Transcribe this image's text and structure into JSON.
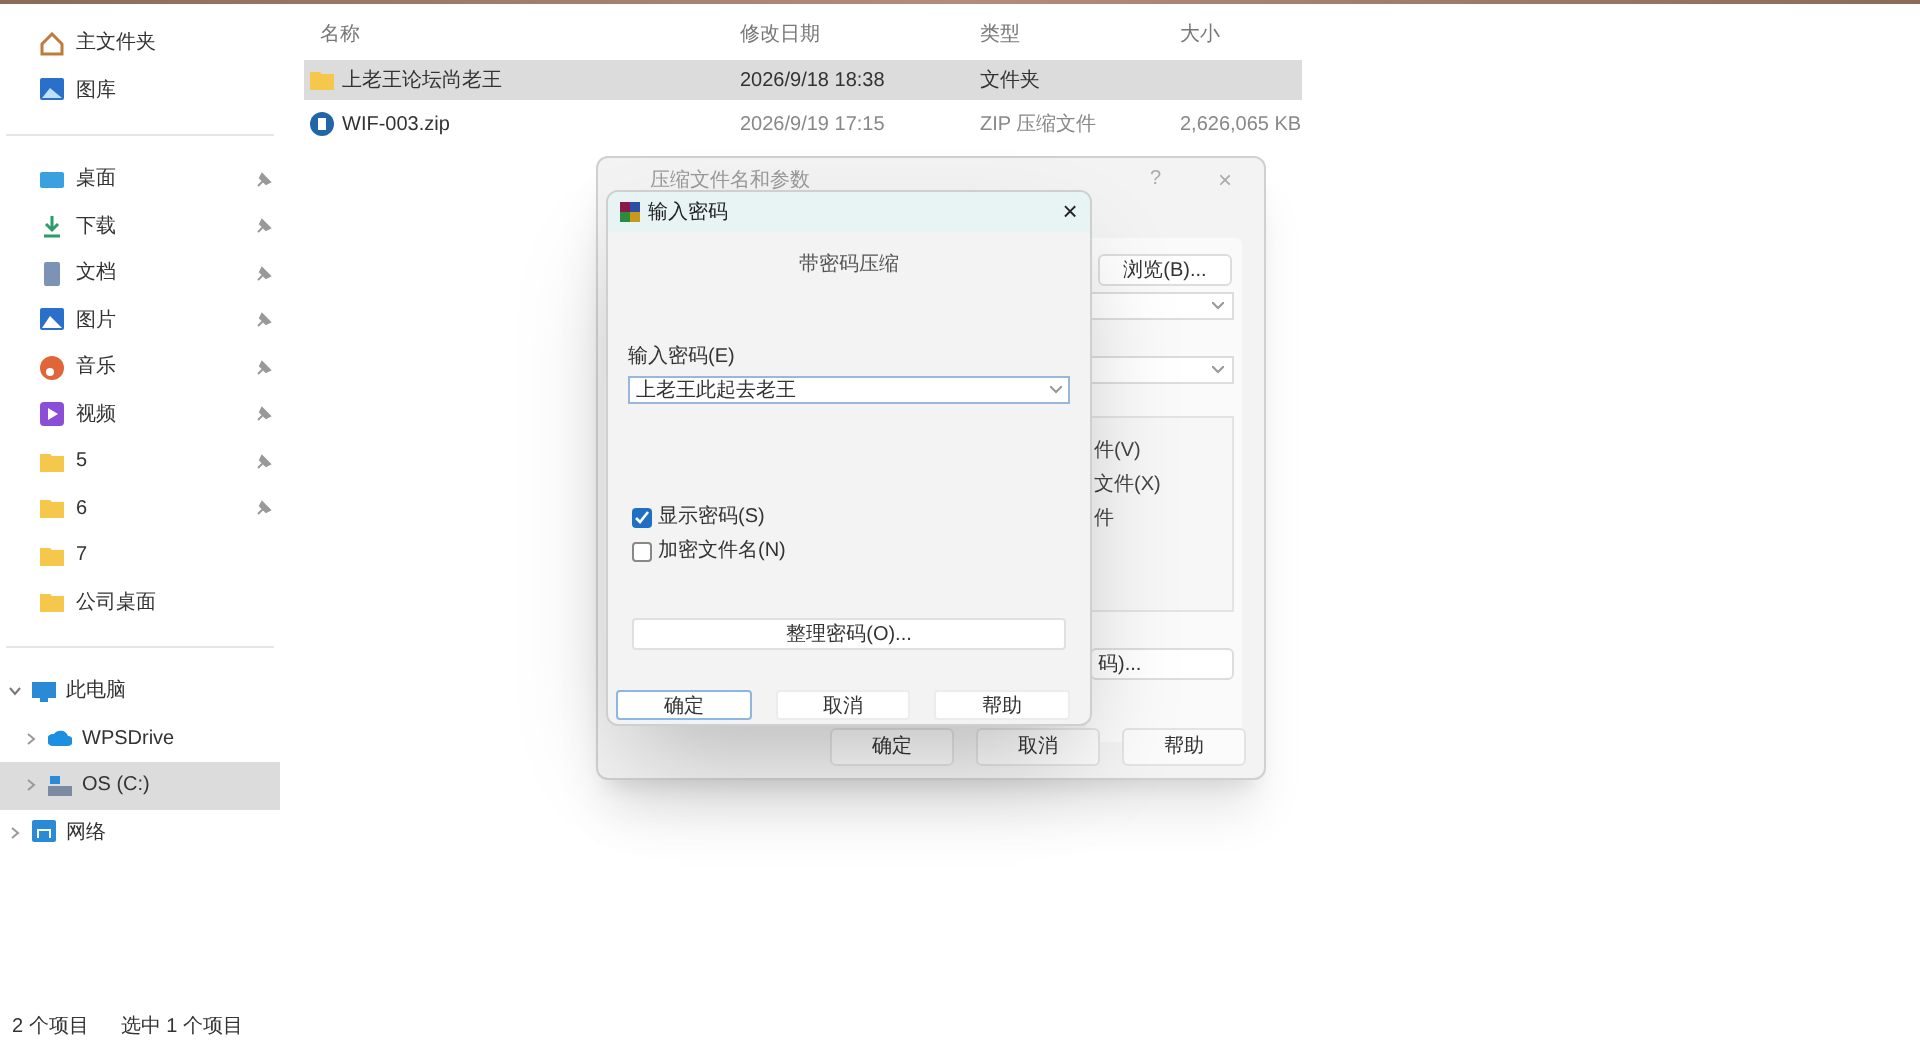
{
  "sidebar": {
    "quick_access": [
      {
        "label": "主文件夹",
        "kind": "home",
        "pinned": false
      },
      {
        "label": "图库",
        "kind": "gallery",
        "pinned": false
      }
    ],
    "pinned_places": [
      {
        "label": "桌面",
        "kind": "desktop",
        "pinned": true
      },
      {
        "label": "下载",
        "kind": "download",
        "pinned": true
      },
      {
        "label": "文档",
        "kind": "documents",
        "pinned": true
      },
      {
        "label": "图片",
        "kind": "pictures",
        "pinned": true
      },
      {
        "label": "音乐",
        "kind": "music",
        "pinned": true
      },
      {
        "label": "视频",
        "kind": "videos",
        "pinned": true
      },
      {
        "label": "5",
        "kind": "folder",
        "pinned": true
      },
      {
        "label": "6",
        "kind": "folder",
        "pinned": true
      },
      {
        "label": "7",
        "kind": "folder",
        "pinned": false
      },
      {
        "label": "公司桌面",
        "kind": "folder",
        "pinned": false
      }
    ],
    "tree": [
      {
        "label": "此电脑",
        "kind": "pc",
        "expanded": true,
        "selected": false,
        "children": [
          {
            "label": "WPSDrive",
            "kind": "cloud",
            "expanded": false,
            "selected": false
          },
          {
            "label": "OS (C:)",
            "kind": "drive",
            "expanded": false,
            "selected": true
          }
        ]
      },
      {
        "label": "网络",
        "kind": "network",
        "expanded": false,
        "selected": false
      }
    ]
  },
  "file_list": {
    "columns": [
      "名称",
      "修改日期",
      "类型",
      "大小"
    ],
    "rows": [
      {
        "kind": "folder",
        "selected": true,
        "cells": [
          "上老王论坛尚老王",
          "2026/9/18 18:38",
          "文件夹",
          ""
        ]
      },
      {
        "kind": "zip",
        "selected": false,
        "cells": [
          "WIF-003.zip",
          "2026/9/19 17:15",
          "ZIP 压缩文件",
          "2,626,065 KB"
        ]
      }
    ]
  },
  "archive_dialog": {
    "title": "压缩文件名和参数",
    "help": "?",
    "close": "×",
    "browse_button": "浏览(B)...",
    "partial_texts": [
      "件(V)",
      "文件(X)",
      "件"
    ],
    "partial_button": "码)...",
    "buttons": [
      "确定",
      "取消",
      "帮助"
    ]
  },
  "password_dialog": {
    "title": "输入密码",
    "close": "×",
    "heading": "带密码压缩",
    "field_label": "输入密码(E)",
    "field_value": "上老王此起去老王",
    "checkboxes": [
      {
        "label": "显示密码(S)",
        "checked": true
      },
      {
        "label": "加密文件名(N)",
        "checked": false
      }
    ],
    "organize_button": "整理密码(O)...",
    "buttons": [
      {
        "label": "确定",
        "default": true
      },
      {
        "label": "取消",
        "default": false
      },
      {
        "label": "帮助",
        "default": false
      }
    ]
  },
  "status_bar": {
    "item_count": "2 个项目",
    "selection": "选中 1 个项目"
  }
}
